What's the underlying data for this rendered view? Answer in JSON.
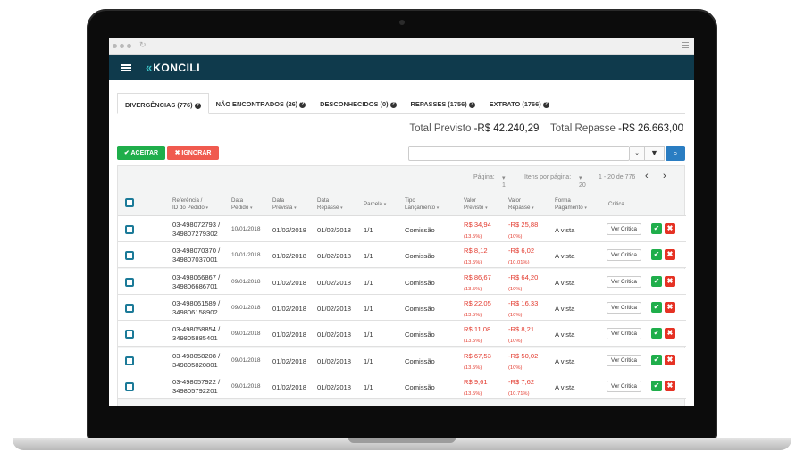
{
  "header": {
    "logo": "KONCILI",
    "logo_mark": "«"
  },
  "tabs": [
    {
      "label": "DIVERGÊNCIAS (776)"
    },
    {
      "label": "NÃO ENCONTRADOS (26)"
    },
    {
      "label": "DESCONHECIDOS (0)"
    },
    {
      "label": "REPASSES (1756)"
    },
    {
      "label": "EXTRATO (1766)"
    }
  ],
  "totals": {
    "previsto_label": "Total Previsto",
    "previsto_value": "-R$ 42.240,29",
    "repasse_label": "Total Repasse",
    "repasse_value": "-R$ 26.663,00"
  },
  "actions": {
    "accept": "✔ ACEITAR",
    "ignore": "✖ IGNORAR"
  },
  "pager": {
    "page_label": "Página:",
    "page_value": "1",
    "per_page_label": "Itens por página:",
    "per_page_value": "20",
    "range": "1 - 20 de 776",
    "prev": "‹",
    "next": "›"
  },
  "columns": {
    "ref_1": "Referência /",
    "ref_2": "ID do Pedido",
    "dp_1": "Data",
    "dp_2": "Pedido",
    "dv_1": "Data",
    "dv_2": "Prevista",
    "dr_1": "Data",
    "dr_2": "Repasse",
    "par": "Parcela",
    "tl_1": "Tipo",
    "tl_2": "Lançamento",
    "vp_1": "Valor",
    "vp_2": "Previsto",
    "vr_1": "Valor",
    "vr_2": "Repasse",
    "fp_1": "Forma",
    "fp_2": "Pagamento",
    "cr": "Crítica"
  },
  "row_button": "Ver Crítica",
  "rows": [
    {
      "ref": "03-498072793 /",
      "id": "349807279302",
      "dp": "10/01/2018",
      "dv": "01/02/2018",
      "dr": "01/02/2018",
      "par": "1/1",
      "tipo": "Comissão",
      "vp": "R$ 34,94",
      "vp_pct": "(13.5%)",
      "vr": "-R$ 25,88",
      "vr_pct": "(10%)",
      "fp": "A vista"
    },
    {
      "ref": "03-498070370 /",
      "id": "349807037001",
      "dp": "10/01/2018",
      "dv": "01/02/2018",
      "dr": "01/02/2018",
      "par": "1/1",
      "tipo": "Comissão",
      "vp": "R$ 8,12",
      "vp_pct": "(13.5%)",
      "vr": "-R$ 6,02",
      "vr_pct": "(10.01%)",
      "fp": "A vista"
    },
    {
      "ref": "03-498066867 /",
      "id": "349806686701",
      "dp": "09/01/2018",
      "dv": "01/02/2018",
      "dr": "01/02/2018",
      "par": "1/1",
      "tipo": "Comissão",
      "vp": "R$ 86,67",
      "vp_pct": "(13.5%)",
      "vr": "-R$ 64,20",
      "vr_pct": "(10%)",
      "fp": "A vista"
    },
    {
      "ref": "03-498061589 /",
      "id": "349806158902",
      "dp": "09/01/2018",
      "dv": "01/02/2018",
      "dr": "01/02/2018",
      "par": "1/1",
      "tipo": "Comissão",
      "vp": "R$ 22,05",
      "vp_pct": "(13.5%)",
      "vr": "-R$ 16,33",
      "vr_pct": "(10%)",
      "fp": "A vista"
    },
    {
      "ref": "03-498058854 /",
      "id": "349805885401",
      "dp": "09/01/2018",
      "dv": "01/02/2018",
      "dr": "01/02/2018",
      "par": "1/1",
      "tipo": "Comissão",
      "vp": "R$ 11,08",
      "vp_pct": "(13.5%)",
      "vr": "-R$ 8,21",
      "vr_pct": "(10%)",
      "fp": "A vista"
    },
    {
      "ref": "03-498058208 /",
      "id": "349805820801",
      "dp": "09/01/2018",
      "dv": "01/02/2018",
      "dr": "01/02/2018",
      "par": "1/1",
      "tipo": "Comissão",
      "vp": "R$ 67,53",
      "vp_pct": "(13.5%)",
      "vr": "-R$ 50,02",
      "vr_pct": "(10%)",
      "fp": "A vista"
    },
    {
      "ref": "03-498057922 /",
      "id": "349805792201",
      "dp": "09/01/2018",
      "dv": "01/02/2018",
      "dr": "01/02/2018",
      "par": "1/1",
      "tipo": "Comissão",
      "vp": "R$ 9,61",
      "vp_pct": "(13.5%)",
      "vr": "-R$ 7,62",
      "vr_pct": "(10.71%)",
      "fp": "A vista"
    }
  ]
}
